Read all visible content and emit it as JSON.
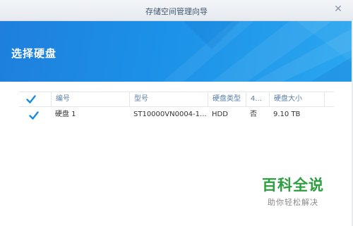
{
  "window": {
    "title": "存储空间管理向导",
    "close_icon": "close-icon"
  },
  "banner": {
    "heading": "选择硬盘"
  },
  "table": {
    "columns": [
      "编号",
      "型号",
      "硬盘类型",
      "4...",
      "硬盘大小"
    ],
    "rows": [
      {
        "checked": true,
        "id": "硬盘 1",
        "model": "ST10000VN0004-1...",
        "type": "HDD",
        "col4": "否",
        "size": "9.10 TB"
      }
    ],
    "header_checked": true
  },
  "watermark": {
    "title": "百科全说",
    "subtitle": "助你轻松解决"
  },
  "colors": {
    "accent": "#1c91e8",
    "check": "#1a8be0",
    "watermark_green": "#2c9e3f"
  }
}
